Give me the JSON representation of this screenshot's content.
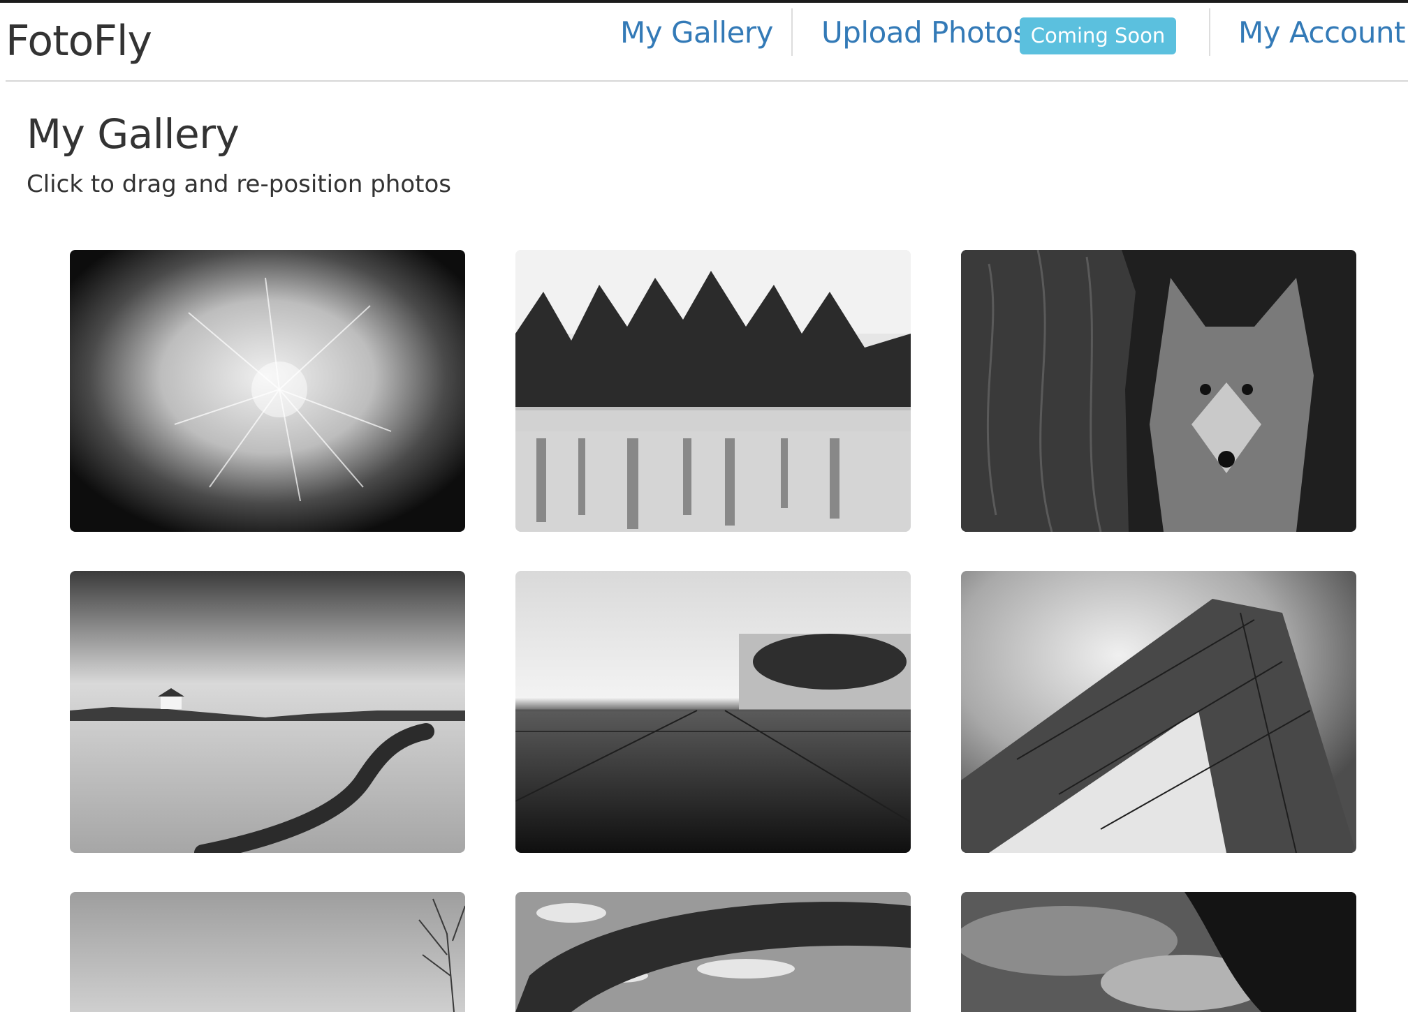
{
  "header": {
    "brand": "FotoFly",
    "nav": {
      "gallery": "My Gallery",
      "upload": "Upload Photos",
      "upload_badge": "Coming Soon",
      "account": "My Account"
    }
  },
  "main": {
    "title": "My Gallery",
    "subtitle": "Click to drag and re-position photos"
  },
  "colors": {
    "link": "#337ab7",
    "badge": "#5bc0de",
    "text": "#333333"
  },
  "gallery": {
    "photos": [
      {
        "subject": "dandelion"
      },
      {
        "subject": "misty-lake-trees"
      },
      {
        "subject": "fox-behind-tree"
      },
      {
        "subject": "coastline-stone-path"
      },
      {
        "subject": "modern-glass-building"
      },
      {
        "subject": "skyscraper-clouds"
      },
      {
        "subject": "bare-tree-fog"
      },
      {
        "subject": "rock-arch"
      },
      {
        "subject": "stormy-sky-tree"
      }
    ]
  }
}
